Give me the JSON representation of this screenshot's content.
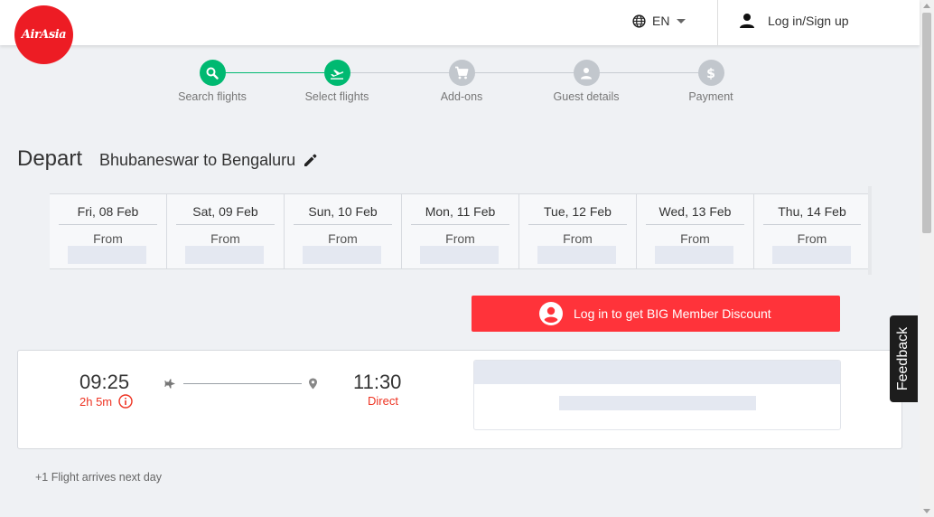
{
  "header": {
    "logo_text": "AirAsia",
    "language": "EN",
    "login_label": "Log in/Sign up"
  },
  "steps": [
    {
      "label": "Search flights",
      "state": "done",
      "icon": "search-icon"
    },
    {
      "label": "Select flights",
      "state": "current",
      "icon": "plane-icon"
    },
    {
      "label": "Add-ons",
      "state": "pending",
      "icon": "cart-icon"
    },
    {
      "label": "Guest details",
      "state": "pending",
      "icon": "person-icon"
    },
    {
      "label": "Payment",
      "state": "pending",
      "icon": "dollar-icon"
    }
  ],
  "depart": {
    "title": "Depart",
    "route": "Bhubaneswar to Bengaluru"
  },
  "dates": [
    {
      "date": "Fri, 08 Feb",
      "from": "From"
    },
    {
      "date": "Sat, 09 Feb",
      "from": "From"
    },
    {
      "date": "Sun, 10 Feb",
      "from": "From"
    },
    {
      "date": "Mon, 11 Feb",
      "from": "From"
    },
    {
      "date": "Tue, 12 Feb",
      "from": "From"
    },
    {
      "date": "Wed, 13 Feb",
      "from": "From"
    },
    {
      "date": "Thu, 14 Feb",
      "from": "From"
    }
  ],
  "member_button": "Log in to get BIG Member Discount",
  "flight": {
    "departure_time": "09:25",
    "duration": "2h 5m",
    "arrival_time": "11:30",
    "stops": "Direct"
  },
  "note": "+1 Flight arrives next day",
  "feedback": "Feedback",
  "colors": {
    "brand_red": "#ed1c24",
    "button_red": "#ff333a",
    "step_active": "#00b971",
    "step_inactive": "#c2c7cd",
    "alert_text": "#ee3322"
  }
}
